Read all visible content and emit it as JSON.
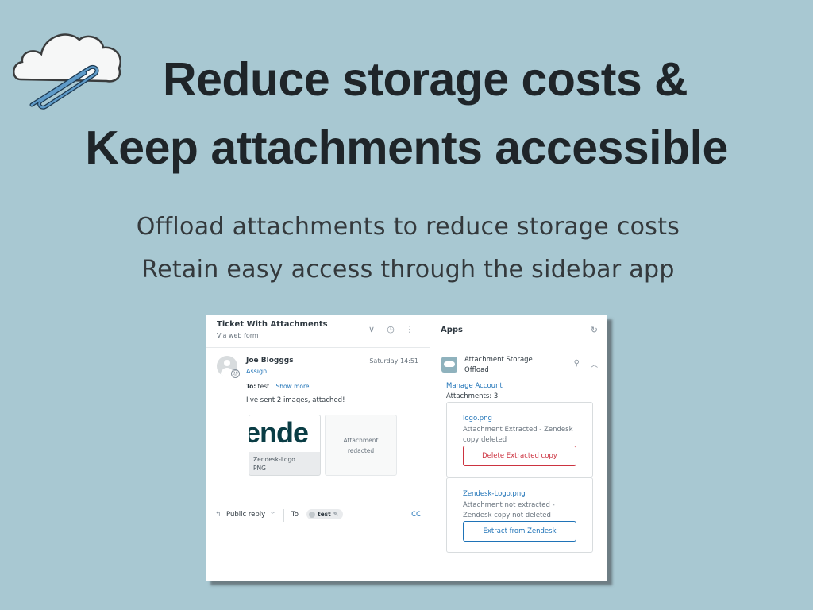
{
  "hero": {
    "logo_icon": "cloud-paperclip-icon",
    "headline_line1": "Reduce storage costs &",
    "headline_line2": "Keep attachments accessible",
    "subline1": "Offload attachments to reduce storage costs",
    "subline2": "Retain easy access through the sidebar app"
  },
  "colors": {
    "background": "#a8c8d2",
    "headline": "#1f2529",
    "link": "#1f73b7",
    "danger": "#cc3340"
  },
  "ticket": {
    "title": "Ticket With Attachments",
    "via": "Via web form",
    "header_icons": [
      "filter-icon",
      "history-icon",
      "more-vertical-icon"
    ],
    "message": {
      "sender": "Joe Blogggs",
      "assign_label": "Assign",
      "timestamp": "Saturday 14:51",
      "to_label": "To:",
      "to_value": "test",
      "show_more": "Show more",
      "body": "I've sent 2 images, attached!",
      "attachments": [
        {
          "preview_text": "ende",
          "name": "Zendesk-Logo",
          "type": "PNG"
        },
        {
          "redacted_line1": "Attachment",
          "redacted_line2": "redacted"
        }
      ]
    },
    "reply": {
      "mode": "Public reply",
      "to_label": "To",
      "recipient": "test",
      "cc_label": "CC"
    }
  },
  "apps_panel": {
    "title": "Apps",
    "app": {
      "name_line1": "Attachment Storage",
      "name_line2": "Offload",
      "manage_link": "Manage Account",
      "count_label": "Attachments: 3",
      "items": [
        {
          "filename": "logo.png",
          "status": "Attachment Extracted - Zendesk copy deleted",
          "action": "Delete Extracted copy"
        },
        {
          "filename": "Zendesk-Logo.png",
          "status": "Attachment not extracted - Zendesk copy not deleted",
          "action": "Extract from Zendesk"
        }
      ]
    }
  }
}
